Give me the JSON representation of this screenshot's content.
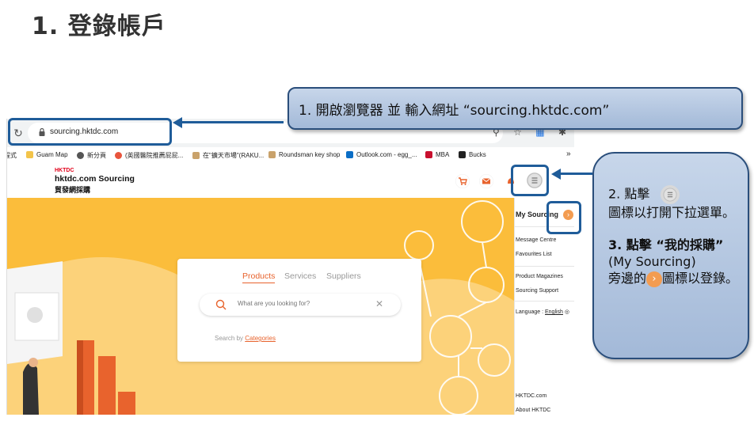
{
  "slide": {
    "title": "1. 登錄帳戶"
  },
  "browser": {
    "url": "sourcing.hktdc.com",
    "bookmarks": [
      {
        "label": "程式",
        "color": "#ffffff"
      },
      {
        "label": "Guam Map",
        "color": "#f3c44a"
      },
      {
        "label": "新分頁",
        "color": "#555555"
      },
      {
        "label": "(英國醫院推薦屁屁...",
        "color": "#e8553d"
      },
      {
        "label": "在\"擴天市場\"(RAKU...",
        "color": "#c9a26b"
      },
      {
        "label": "Roundsman key shop",
        "color": "#c9a26b"
      },
      {
        "label": "Outlook.com - egg_...",
        "color": "#0b6ec6"
      },
      {
        "label": "MBA",
        "color": "#c8102e"
      },
      {
        "label": "Bucks",
        "color": "#222222"
      }
    ],
    "bookmarks_more": "»"
  },
  "site": {
    "logo_mark": "HKTDC",
    "name": "hktdc.com Sourcing",
    "name_zh": "貿發網採購",
    "search": {
      "tabs": [
        "Products",
        "Services",
        "Suppliers"
      ],
      "placeholder": "What are you looking for?",
      "search_by_prefix": "Search by ",
      "search_by_link": "Categories"
    },
    "menu": {
      "title": "My Sourcing",
      "items_group1": [
        "Message Centre",
        "Favourites List"
      ],
      "items_group2": [
        "Product Magazines",
        "Sourcing Support"
      ],
      "language_label": "Language : ",
      "language_value": "English",
      "items_footer": [
        "HKTDC.com",
        "About HKTDC"
      ]
    }
  },
  "callouts": {
    "step1": "1. 開啟瀏覽器 並 輸入網址 “sourcing.hktdc.com”",
    "step2_prefix": "2. 點擊",
    "step2_suffix": "圖標以打開下拉選單。",
    "step3_line1": "3. 點擊 “我的採購”",
    "step3_line2": "(My Sourcing)",
    "step3_line3_prefix": "旁邊的",
    "step3_line3_suffix": "圖標以登錄。"
  },
  "colors": {
    "accent_blue": "#1f5c99",
    "hero_orange": "#fbbd3b",
    "hktdc_orange": "#e8632d"
  }
}
